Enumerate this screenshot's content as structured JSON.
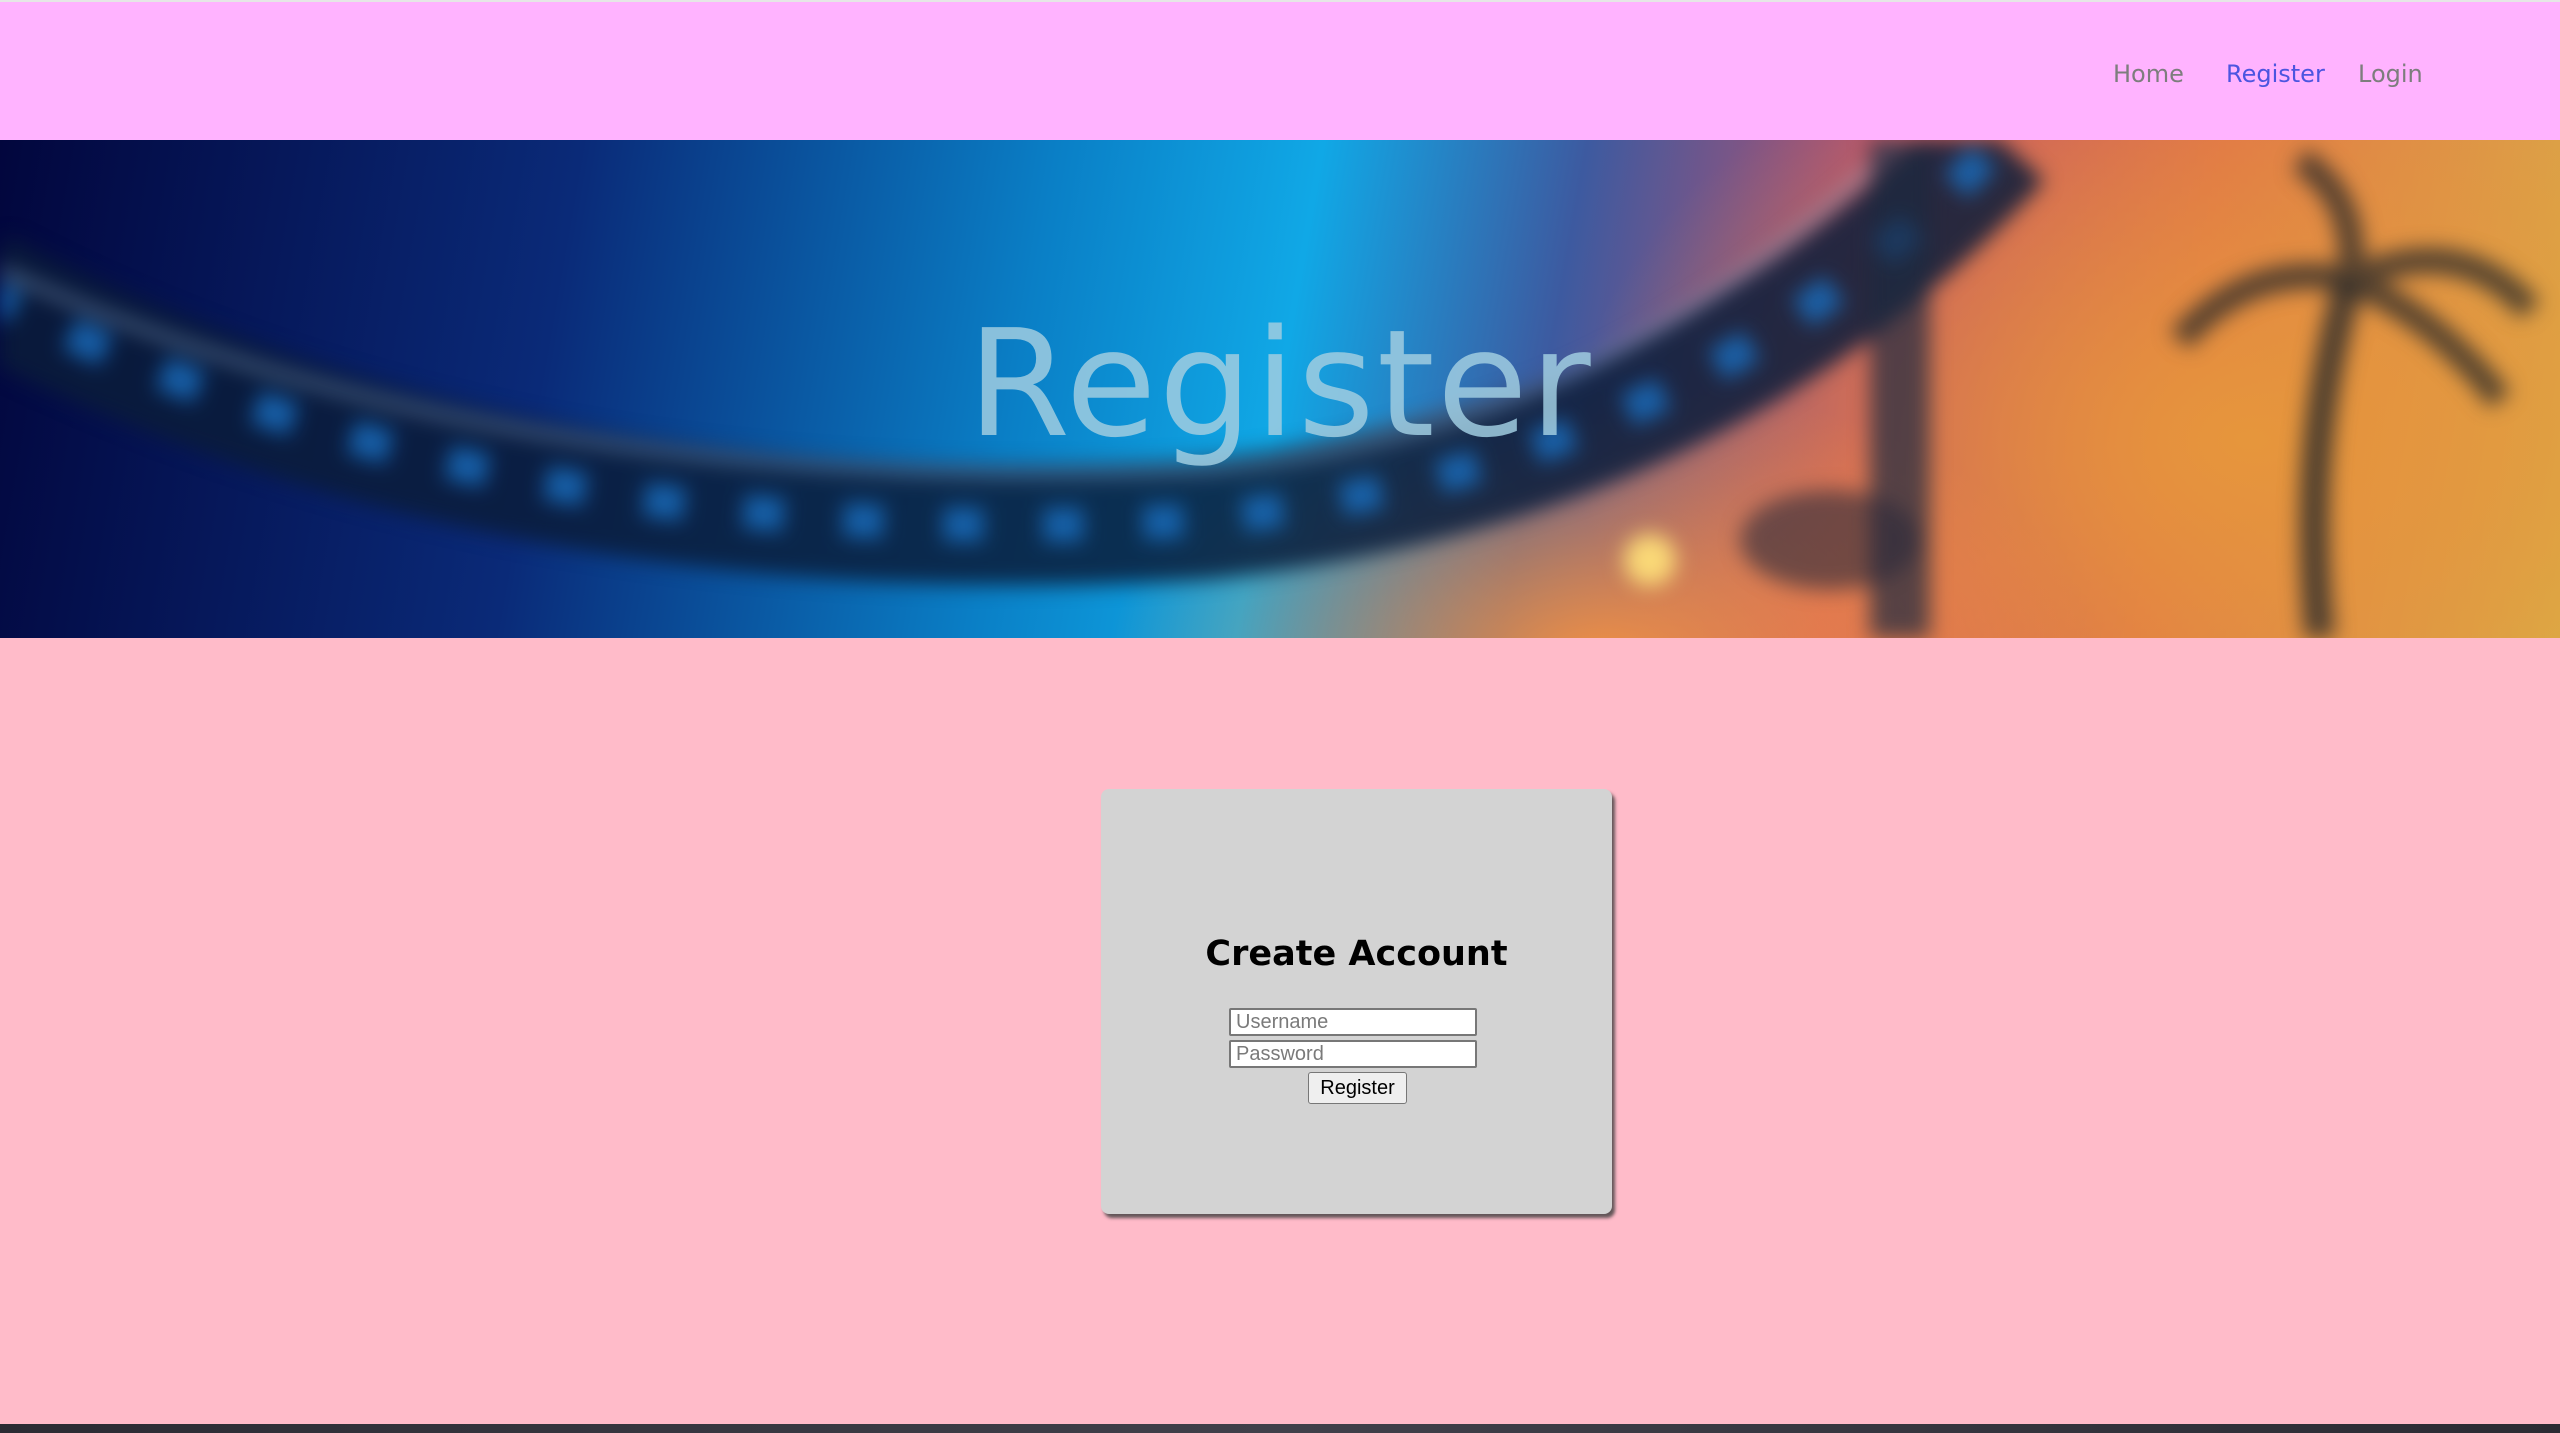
{
  "nav": {
    "links": [
      {
        "label": "Home"
      },
      {
        "label": "Register"
      },
      {
        "label": "Login"
      }
    ],
    "active_color": "#4c55e0",
    "inactive_color": "#7d7d7d",
    "background": "#ffb3ff"
  },
  "hero": {
    "title": "Register"
  },
  "form": {
    "title": "Create Account",
    "username_placeholder": "Username",
    "password_placeholder": "Password",
    "submit_label": "Register"
  },
  "colors": {
    "page_background": "#ffbbc9",
    "card_background": "#d3d3d3"
  }
}
